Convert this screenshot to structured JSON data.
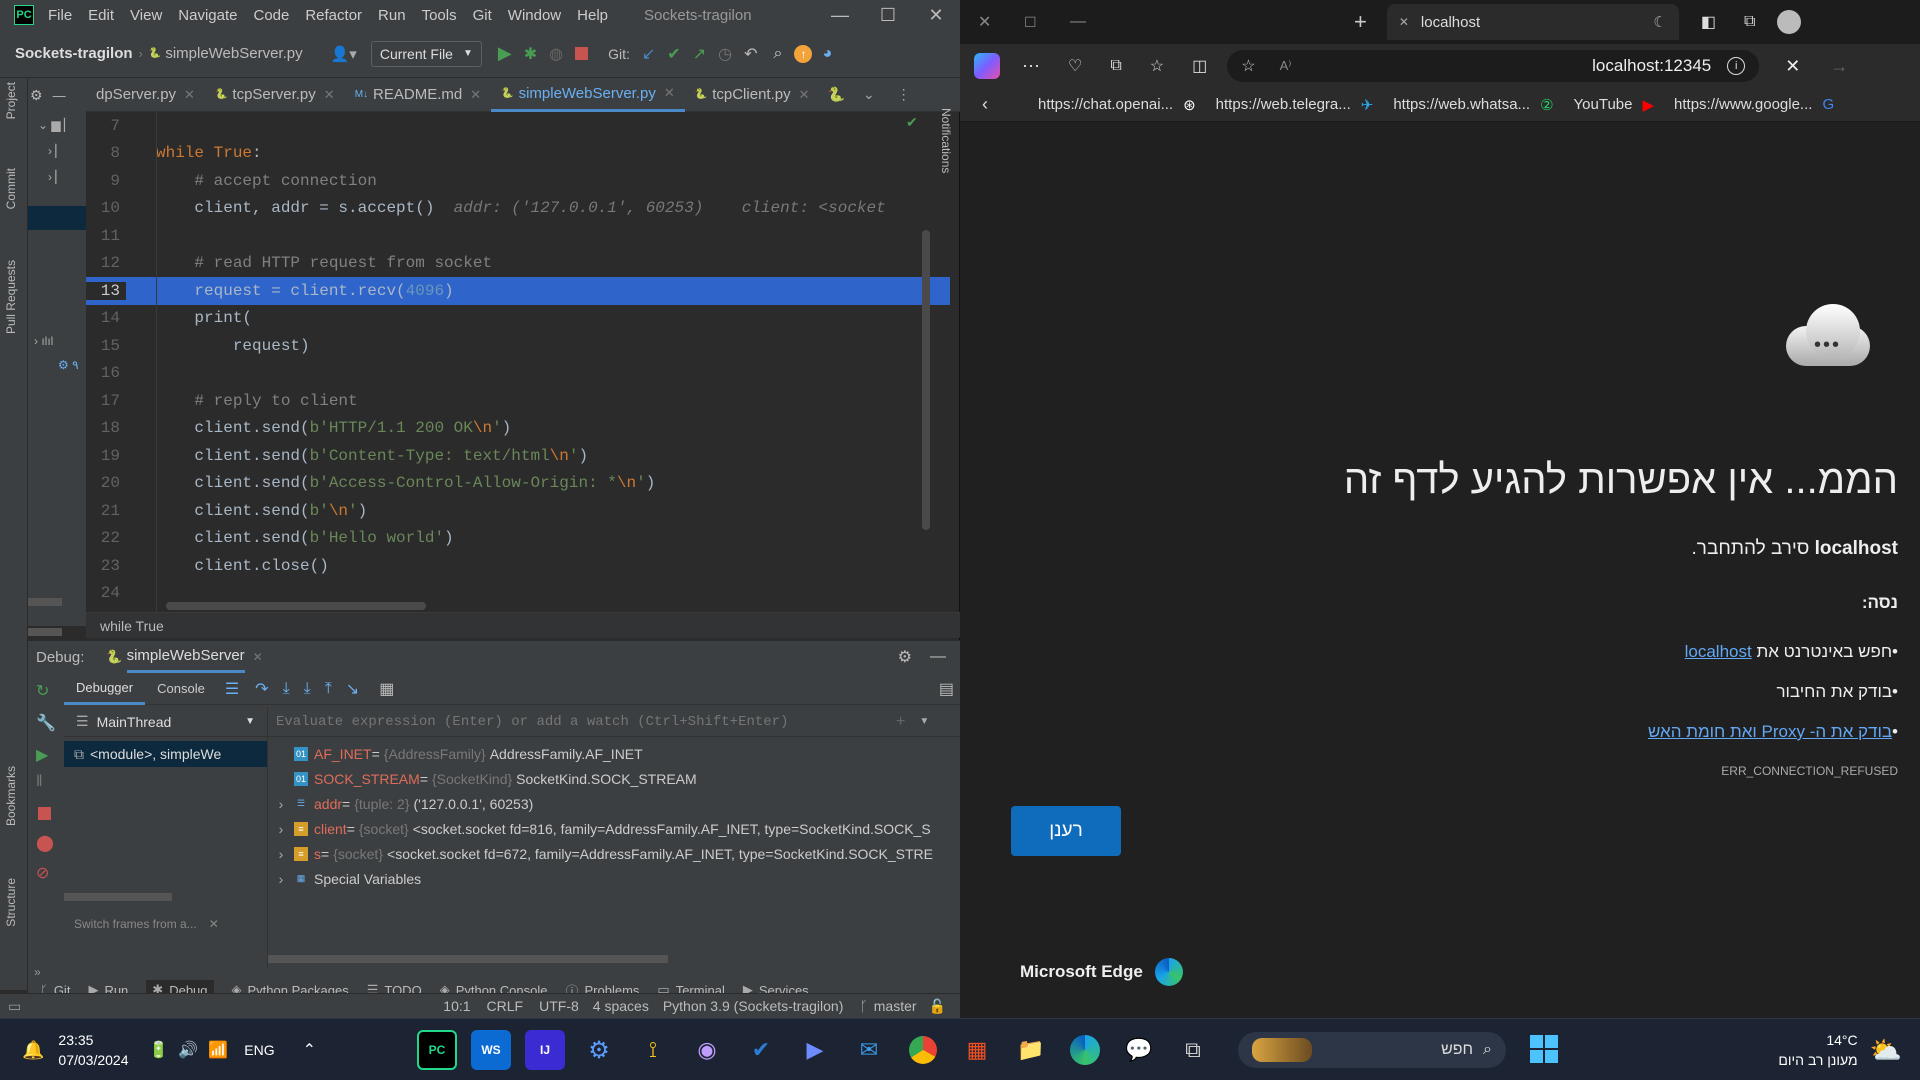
{
  "ide": {
    "menu": [
      "File",
      "Edit",
      "View",
      "Navigate",
      "Code",
      "Refactor",
      "Run",
      "Tools",
      "Git",
      "Window",
      "Help"
    ],
    "project_title": "Sockets-tragilon",
    "breadcrumb_file": "simpleWebServer.py",
    "run_config": "Current File",
    "git_label": "Git:",
    "tabs": [
      {
        "label": "dpServer.py",
        "active": false
      },
      {
        "label": "tcpServer.py",
        "active": false
      },
      {
        "label": "README.md",
        "active": false
      },
      {
        "label": "simpleWebServer.py",
        "active": true
      },
      {
        "label": "tcpClient.py",
        "active": false
      }
    ],
    "side_left": {
      "project": "Project",
      "commit": "Commit",
      "pull_requests": "Pull Requests",
      "bookmarks": "Bookmarks",
      "structure": "Structure"
    },
    "side_right": {
      "notifications": "Notifications"
    },
    "code_lines": [
      {
        "n": "7",
        "html": ""
      },
      {
        "n": "8",
        "html": "<span class='kw'>while</span> <span class='kw'>True</span>:"
      },
      {
        "n": "9",
        "html": "    <span class='cm'># accept connection</span>"
      },
      {
        "n": "10",
        "html": "    client, addr = s.accept()  <span class='hint'>addr: ('127.0.0.1', 60253)    client: &lt;socket</span>"
      },
      {
        "n": "11",
        "html": ""
      },
      {
        "n": "12",
        "html": "    <span class='cm'># read HTTP request from socket</span>"
      },
      {
        "n": "13",
        "html": "    request = client.recv(<span class='nm'>4096</span>)",
        "hl": true
      },
      {
        "n": "14",
        "html": "    print("
      },
      {
        "n": "15",
        "html": "        request)"
      },
      {
        "n": "16",
        "html": ""
      },
      {
        "n": "17",
        "html": "    <span class='cm'># reply to client</span>"
      },
      {
        "n": "18",
        "html": "    client.send(<span class='st'>b'HTTP/1.1 200 OK<span class='kw'>\\n</span>'</span>)"
      },
      {
        "n": "19",
        "html": "    client.send(<span class='st'>b'Content-Type: text/html<span class='kw'>\\n</span>'</span>)"
      },
      {
        "n": "20",
        "html": "    client.send(<span class='st'>b'Access-Control-Allow-Origin: *<span class='kw'>\\n</span>'</span>)"
      },
      {
        "n": "21",
        "html": "    client.send(<span class='st'>b'<span class='kw'>\\n</span>'</span>)"
      },
      {
        "n": "22",
        "html": "    client.send(<span class='st'>b'Hello world'</span>)"
      },
      {
        "n": "23",
        "html": "    client.close()"
      },
      {
        "n": "24",
        "html": ""
      }
    ],
    "breadcrumb_bottom": "while True",
    "debug": {
      "label": "Debug:",
      "session": "simpleWebServer",
      "tabs": [
        "Debugger",
        "Console"
      ],
      "thread": "MainThread",
      "frame": "<module>, simpleWe",
      "eval_placeholder": "Evaluate expression (Enter) or add a watch (Ctrl+Shift+Enter)",
      "switch_frames": "Switch frames from a...",
      "vars": [
        {
          "name": "AF_INET",
          "type": "{AddressFamily}",
          "value": "AddressFamily.AF_INET",
          "expand": false,
          "icon": "01"
        },
        {
          "name": "SOCK_STREAM",
          "type": "{SocketKind}",
          "value": "SocketKind.SOCK_STREAM",
          "expand": false,
          "icon": "01"
        },
        {
          "name": "addr",
          "type": "{tuple: 2}",
          "value": "('127.0.0.1', 60253)",
          "expand": true,
          "icon": "list"
        },
        {
          "name": "client",
          "type": "{socket}",
          "value": "<socket.socket fd=816, family=AddressFamily.AF_INET, type=SocketKind.SOCK_S",
          "expand": true,
          "icon": "obj"
        },
        {
          "name": "s",
          "type": "{socket}",
          "value": "<socket.socket fd=672, family=AddressFamily.AF_INET, type=SocketKind.SOCK_STRE",
          "expand": true,
          "icon": "obj"
        },
        {
          "name": "Special Variables",
          "type": "",
          "value": "",
          "expand": true,
          "icon": "grid"
        }
      ]
    },
    "bottom_tabs": [
      "Git",
      "Run",
      "Debug",
      "Python Packages",
      "TODO",
      "Python Console",
      "Problems",
      "Terminal",
      "Services"
    ],
    "status": {
      "pos": "10:1",
      "eol": "CRLF",
      "enc": "UTF-8",
      "indent": "4 spaces",
      "interp": "Python 3.9 (Sockets-tragilon)",
      "branch": "master"
    }
  },
  "edge": {
    "tab_title": "localhost",
    "address": "localhost:12345",
    "bookmarks": [
      "https://chat.openai...",
      "https://web.telegra...",
      "https://web.whatsa...",
      "YouTube",
      "https://www.google..."
    ],
    "whatsapp_badge": "2",
    "error_title": "הממ... אין אפשרות להגיע לדף זה",
    "error_host": "localhost",
    "error_refused": " סירב להתחבר.",
    "try_label": "נסה:",
    "suggestions": {
      "s1_pre": "חפש באינטרנט את ",
      "s1_link": "localhost",
      "s2": "בודק את החיבור",
      "s3_link": "בודק את ה- Proxy ואת חומת האש"
    },
    "error_code": "ERR_CONNECTION_REFUSED",
    "refresh": "רענן",
    "brand": "Microsoft Edge"
  },
  "taskbar": {
    "time": "23:35",
    "date": "07/03/2024",
    "lang": "ENG",
    "search_placeholder": "חפש",
    "weather_temp": "14°C",
    "weather_desc": "מעונן רב היום"
  },
  "colors": {
    "accent_blue": "#2f65ca",
    "edge_refresh": "#0f6cbd",
    "link": "#62a8f5"
  }
}
